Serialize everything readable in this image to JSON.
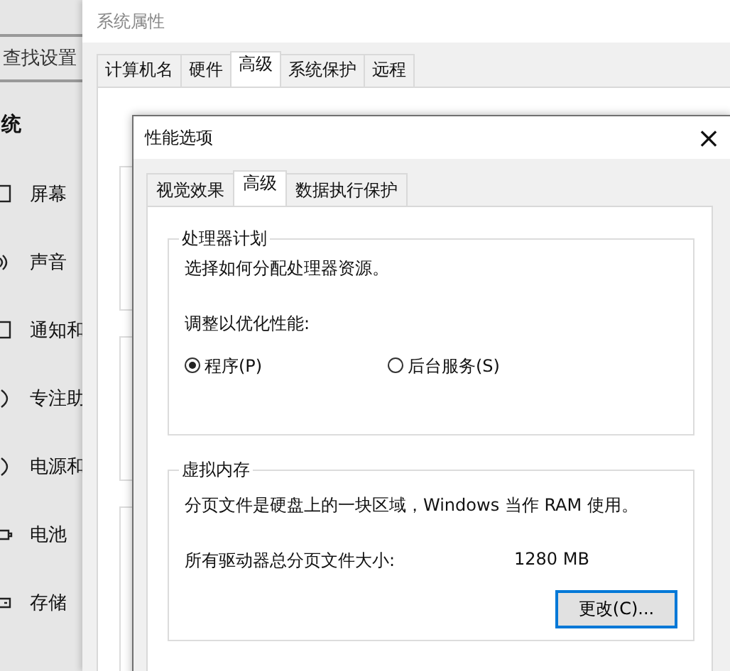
{
  "settings_app": {
    "search": {
      "placeholder": "查找设置"
    },
    "heading": "统",
    "nav": [
      {
        "label": "屏幕"
      },
      {
        "label": "声音"
      },
      {
        "label": "通知和"
      },
      {
        "label": "专注助"
      },
      {
        "label": "电源和"
      },
      {
        "label": "电池"
      },
      {
        "label": "存储"
      }
    ]
  },
  "system_properties": {
    "title": "系统属性",
    "tabs": [
      {
        "label": "计算机名",
        "selected": false
      },
      {
        "label": "硬件",
        "selected": false
      },
      {
        "label": "高级",
        "selected": true
      },
      {
        "label": "系统保护",
        "selected": false
      },
      {
        "label": "远程",
        "selected": false
      }
    ]
  },
  "dialog": {
    "title": "性能选项",
    "close": "×",
    "tabs": [
      {
        "label": "视觉效果",
        "selected": false
      },
      {
        "label": "高级",
        "selected": true
      },
      {
        "label": "数据执行保护",
        "selected": false
      }
    ],
    "processor_group": {
      "title": "处理器计划",
      "description": "选择如何分配处理器资源。",
      "prompt": "调整以优化性能:",
      "options": [
        {
          "label": "程序(P)",
          "selected": true
        },
        {
          "label": "后台服务(S)",
          "selected": false
        }
      ]
    },
    "memory_group": {
      "title": "虚拟内存",
      "description": "分页文件是硬盘上的一块区域，Windows 当作 RAM 使用。",
      "size_label": "所有驱动器总分页文件大小:",
      "size_value": "1280 MB",
      "button": {
        "label": "更改(C)...",
        "focused": true
      }
    }
  }
}
